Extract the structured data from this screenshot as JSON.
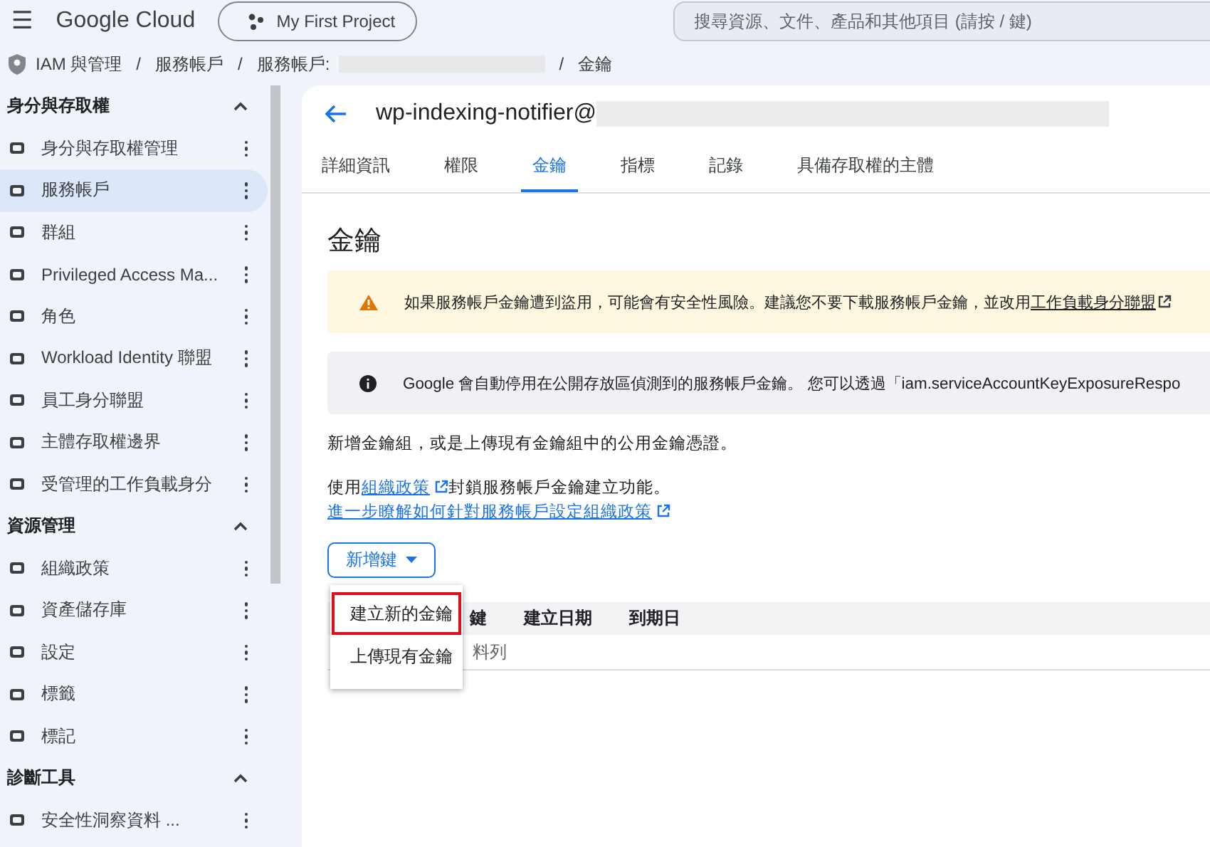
{
  "topbar": {
    "menu_icon": "☰",
    "logo": "Google Cloud",
    "project": "My First Project",
    "search": {
      "placeholder": "搜尋資源、文件、產品和其他項目 (請按 / 鍵)"
    }
  },
  "breadcrumb": {
    "items": [
      "IAM 與管理",
      "服務帳戶",
      "服務帳戶:"
    ],
    "separator": "/",
    "last": "金鑰"
  },
  "sidebar": {
    "sections": [
      {
        "title": "身分與存取權",
        "expanded": true,
        "items": [
          {
            "label": "身分與存取權管理",
            "selected": false
          },
          {
            "label": "服務帳戶",
            "selected": true
          },
          {
            "label": "群組",
            "selected": false
          },
          {
            "label": "Privileged Access Ma...",
            "selected": false
          },
          {
            "label": "角色",
            "selected": false
          },
          {
            "label": "Workload Identity 聯盟",
            "selected": false
          },
          {
            "label": "員工身分聯盟",
            "selected": false
          },
          {
            "label": "主體存取權邊界",
            "selected": false
          },
          {
            "label": "受管理的工作負載身分",
            "selected": false
          }
        ]
      },
      {
        "title": "資源管理",
        "expanded": true,
        "items": [
          {
            "label": "組織政策",
            "selected": false
          },
          {
            "label": "資產儲存庫",
            "selected": false
          },
          {
            "label": "設定",
            "selected": false
          },
          {
            "label": "標籤",
            "selected": false
          },
          {
            "label": "標記",
            "selected": false
          }
        ]
      },
      {
        "title": "診斷工具",
        "expanded": true,
        "items": [
          {
            "label": "安全性洞察資料 ...",
            "selected": false
          }
        ]
      }
    ]
  },
  "header": {
    "title": "wp-indexing-notifier@"
  },
  "tabs": [
    {
      "label": "詳細資訊",
      "selected": false
    },
    {
      "label": "權限",
      "selected": false
    },
    {
      "label": "金鑰",
      "selected": true
    },
    {
      "label": "指標",
      "selected": false
    },
    {
      "label": "記錄",
      "selected": false
    },
    {
      "label": "具備存取權的主體",
      "selected": false
    }
  ],
  "heading": "金鑰",
  "alerts": [
    {
      "kind": "warning",
      "text": "如果服務帳戶金鑰遭到盜用，可能會有安全性風險。建議您不要下載服務帳戶金鑰，並改用",
      "link": "工作負載身分聯盟"
    },
    {
      "kind": "info",
      "text": "Google 會自動停用在公開存放區偵測到的服務帳戶金鑰。 您可以透過「iam.serviceAccountKeyExposureRespo"
    }
  ],
  "intro": "新增金鑰組，或是上傳現有金鑰組中的公用金鑰憑證。",
  "policy": {
    "before": "使用",
    "link": "組織政策",
    "after": "封鎖服務帳戶金鑰建立功能。"
  },
  "learn_link": "進一步瞭解如何針對服務帳戶設定組織政策",
  "add_key": {
    "label": "新增鍵",
    "expanded": true,
    "menu": [
      {
        "label": "建立新的金鑰",
        "highlighted": true
      },
      {
        "label": "上傳現有金鑰",
        "highlighted": false
      }
    ]
  },
  "table": {
    "columns": [
      "鍵",
      "建立日期",
      "到期日"
    ],
    "empty_text": "料列"
  }
}
